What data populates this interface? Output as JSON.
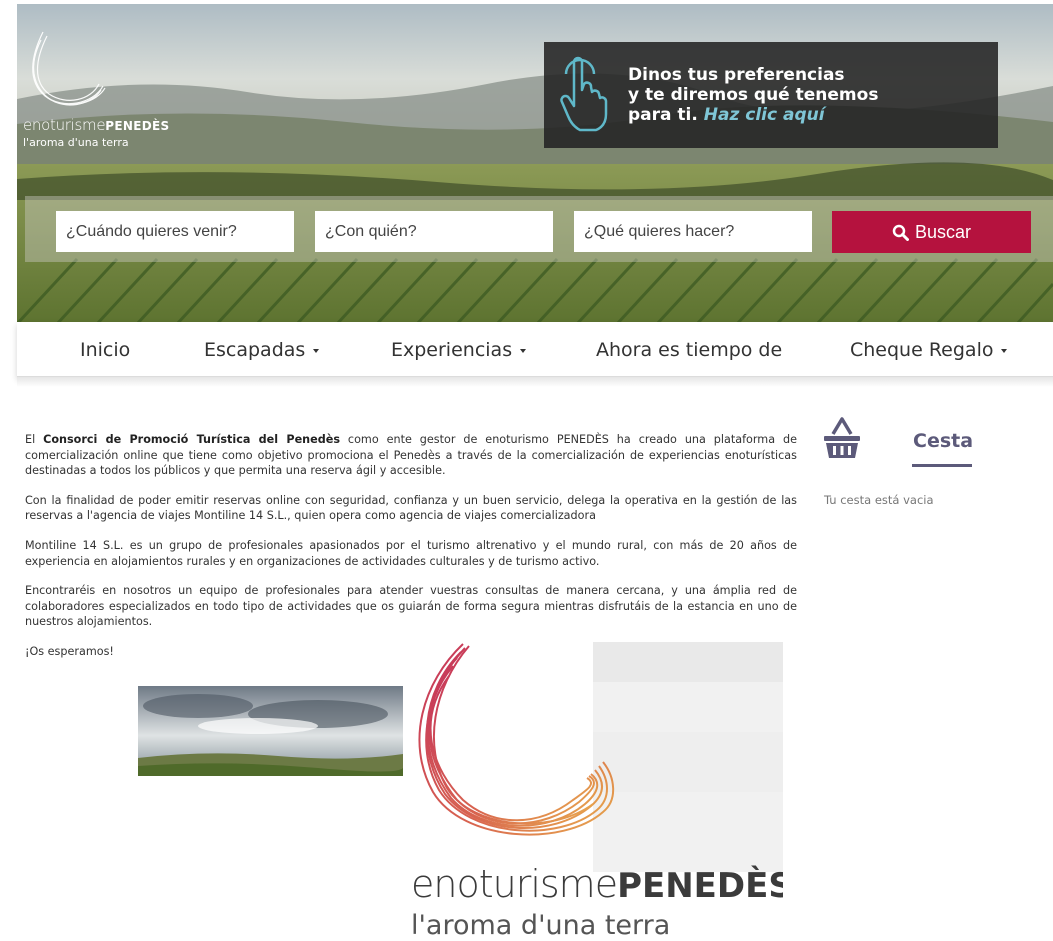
{
  "brand": {
    "name_light": "enoturisme",
    "name_bold": "PENEDÈS",
    "tagline": "l'aroma d'una terra"
  },
  "promo": {
    "line1": "Dinos tus preferencias",
    "line2": "y te diremos qué tenemos",
    "line3": "para ti.",
    "cta": "Haz clic aquí"
  },
  "search": {
    "when_placeholder": "¿Cuándo quieres venir?",
    "who_placeholder": "¿Con quién?",
    "what_placeholder": "¿Qué quieres hacer?",
    "button_label": "Buscar"
  },
  "nav": {
    "items": [
      {
        "label": "Inicio",
        "dropdown": false
      },
      {
        "label": "Escapadas",
        "dropdown": true
      },
      {
        "label": "Experiencias",
        "dropdown": true
      },
      {
        "label": "Ahora es tiempo de",
        "dropdown": false
      },
      {
        "label": "Cheque Regalo",
        "dropdown": true
      }
    ]
  },
  "content": {
    "p1_pre": "El ",
    "p1_bold": "Consorci de Promoció Turística del Penedès",
    "p1_post": " como ente gestor de enoturismo PENEDÈS ha creado una plataforma de comercialización online que tiene como objetivo promociona el Penedès a través de la comercialización de experiencias enoturísticas destinadas a todos los públicos y que permita una reserva ágil y accesible.",
    "p2": "Con la finalidad de poder emitir reservas online con seguridad, confianza y un buen servicio, delega la operativa en la gestión de las reservas a l'agencia de viajes Montiline 14 S.L., quien opera como agencia de viajes comercializadora",
    "p3": "Montiline 14 S.L. es un grupo de profesionales apasionados por el turismo altrenativo y el mundo rural, con más de 20 años de experiencia en alojamientos rurales y en organizaciones de actividades culturales y de turismo activo.",
    "p4": "Encontraréis en nosotros un equipo de profesionales para atender vuestras consultas de manera cercana, y una ámplia red de colaboradores especializados en todo tipo de actividades que os guiarán de forma segura mientras disfrutáis de la estancia en uno de nuestros alojamientos.",
    "p5": "¡Os esperamos!"
  },
  "cart": {
    "title": "Cesta",
    "empty": "Tu cesta está vacia"
  },
  "colors": {
    "accent": "#b5123e",
    "cart": "#5c5a7a",
    "promo_cta": "#7fc6d6"
  }
}
